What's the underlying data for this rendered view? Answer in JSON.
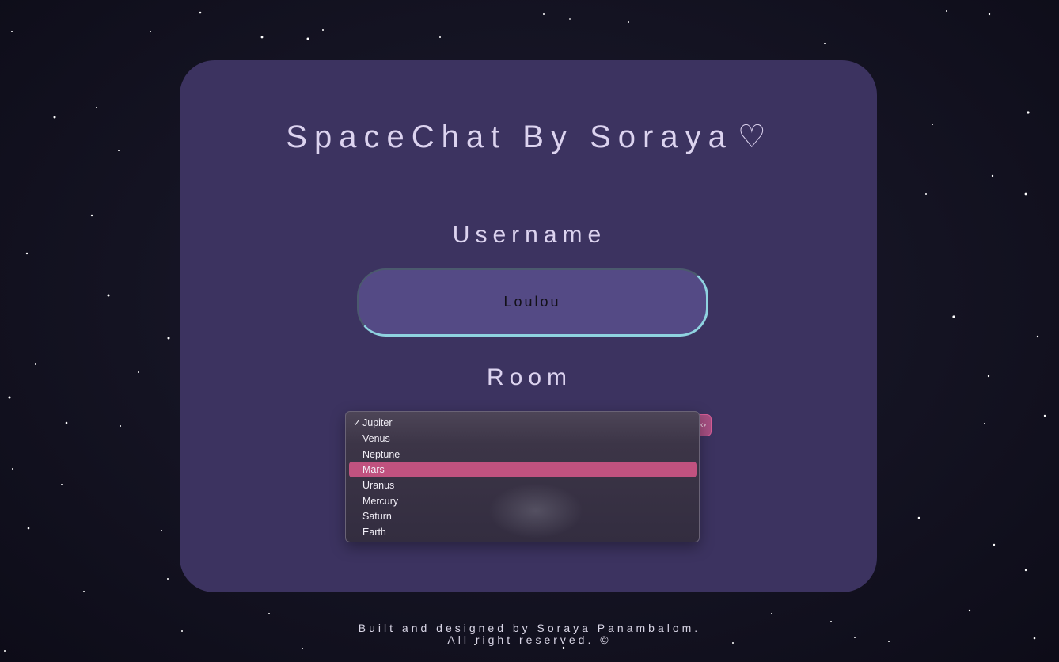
{
  "page": {
    "title": "SpaceChat By Soraya",
    "title_icon": "heart-outline-icon",
    "title_icon_glyph": "♡"
  },
  "form": {
    "username_label": "Username",
    "username_value": "Loulou",
    "room_label": "Room",
    "room_select_icon": "chevron-icon",
    "room_select_glyph": "‹›"
  },
  "room_menu": {
    "checked": "Jupiter",
    "highlighted": "Mars",
    "check_glyph": "✓",
    "options": [
      "Jupiter",
      "Venus",
      "Neptune",
      "Mars",
      "Uranus",
      "Mercury",
      "Saturn",
      "Earth"
    ]
  },
  "footer": {
    "line1": "Built and designed by Soraya Panambalom.",
    "line2": "All right reserved. ©"
  },
  "colors": {
    "background": "#141322",
    "card": "#3c3360",
    "input": "#544a85",
    "input_accent": "#8fd3e0",
    "highlight": "#c0527f",
    "text": "#dcd3ef"
  }
}
